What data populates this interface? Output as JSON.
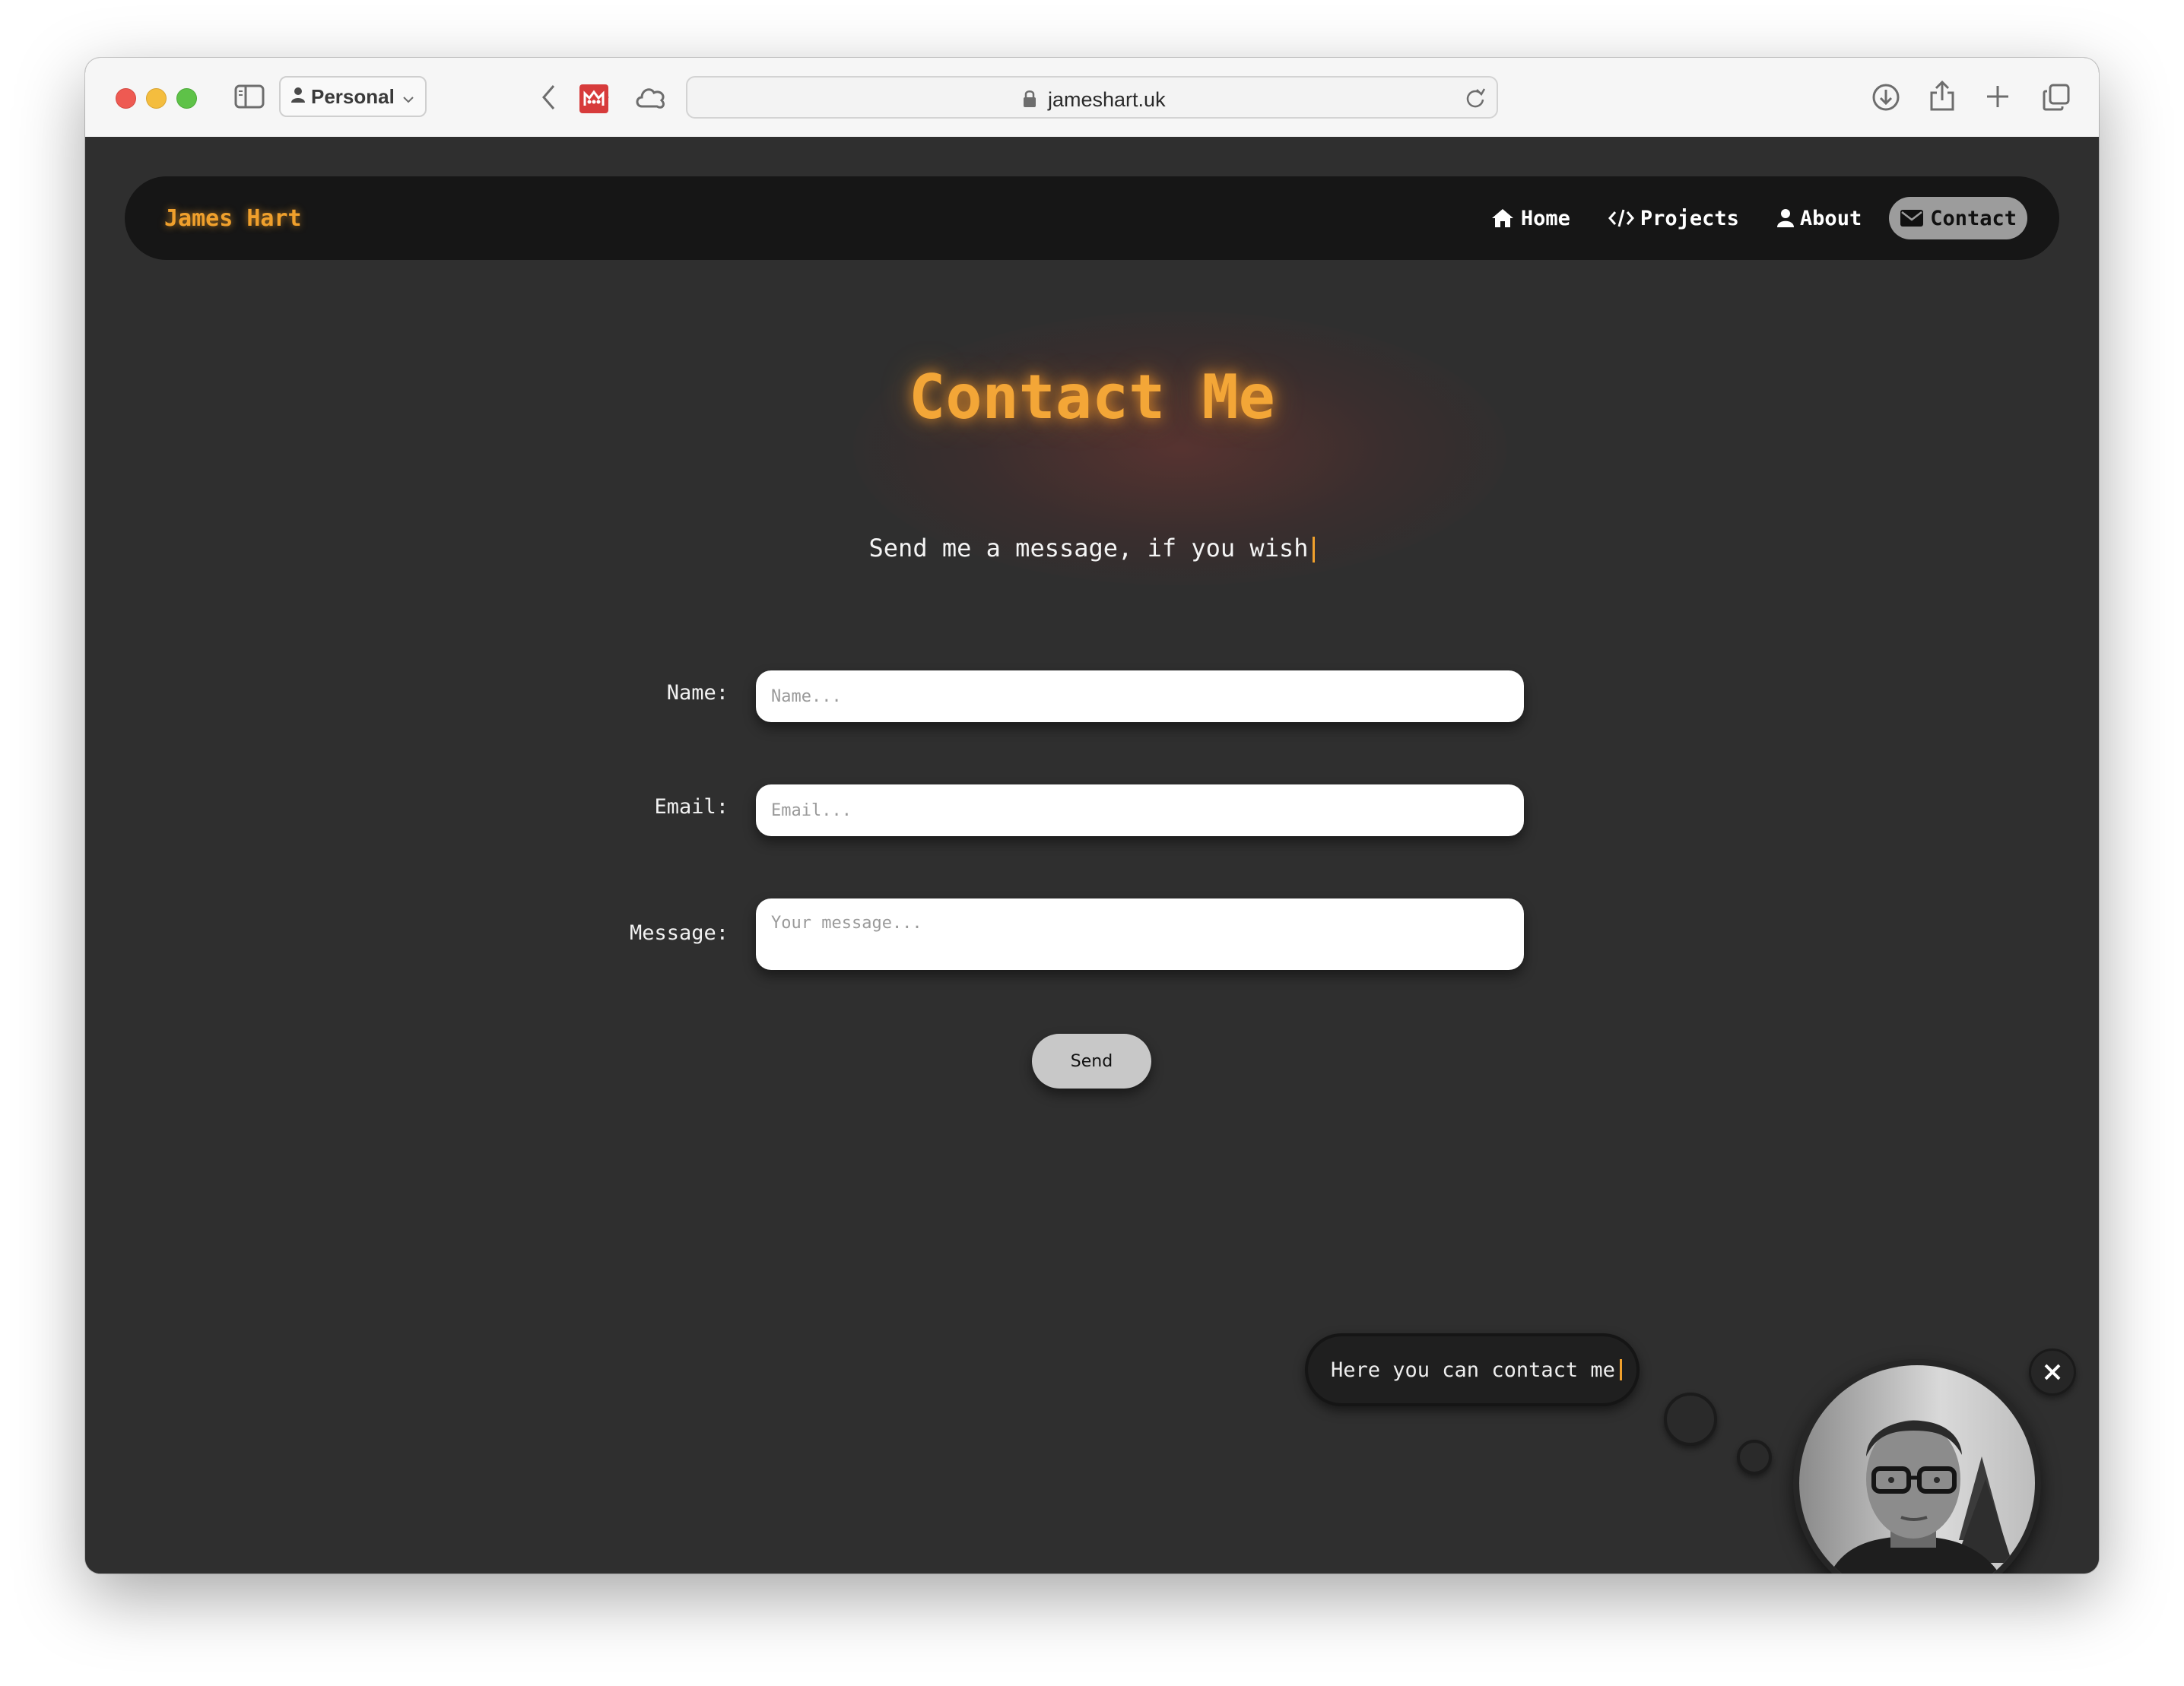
{
  "browser": {
    "profile_label": "Personal",
    "url": "jameshart.uk"
  },
  "nav": {
    "brand": "James Hart",
    "links": [
      {
        "label": "Home",
        "icon": "home-icon"
      },
      {
        "label": "Projects",
        "icon": "code-icon"
      },
      {
        "label": "About",
        "icon": "user-icon"
      },
      {
        "label": "Contact",
        "icon": "envelope-icon",
        "active": true
      }
    ]
  },
  "hero": {
    "title": "Contact Me",
    "subtitle": "Send me a message, if you wish"
  },
  "form": {
    "name_label": "Name:",
    "name_placeholder": "Name...",
    "email_label": "Email:",
    "email_placeholder": "Email...",
    "message_label": "Message:",
    "message_placeholder": "Your message...",
    "send_label": "Send"
  },
  "assistant": {
    "bubble_text": "Here you can contact me"
  },
  "colors": {
    "accent": "#f0a02c",
    "page_bg": "#2f2f2f",
    "nav_bg": "#161616"
  }
}
